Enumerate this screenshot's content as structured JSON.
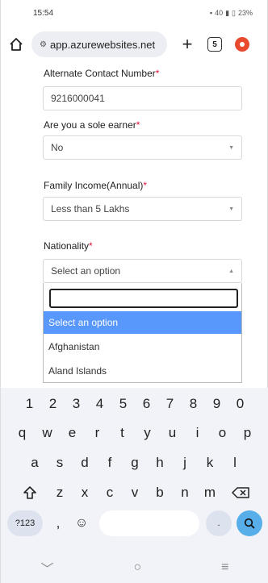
{
  "status": {
    "time": "15:54",
    "signal": "40",
    "battery": "23%"
  },
  "browser": {
    "url": "app.azurewebsites.net",
    "tab_count": "5",
    "plus": "+"
  },
  "form": {
    "alt_contact": {
      "label": "Alternate Contact Number",
      "value": "9216000041"
    },
    "sole_earner": {
      "label": "Are you a sole earner",
      "value": "No"
    },
    "family_income": {
      "label": "Family Income(Annual)",
      "value": "Less than 5 Lakhs"
    },
    "nationality": {
      "label": "Nationality",
      "value": "Select an option"
    },
    "required_mark": "*"
  },
  "dropdown": {
    "options": [
      "Select an option",
      "Afghanistan",
      "Aland Islands"
    ],
    "selected_index": 0
  },
  "keyboard": {
    "row1": [
      "1",
      "2",
      "3",
      "4",
      "5",
      "6",
      "7",
      "8",
      "9",
      "0"
    ],
    "row2": [
      "q",
      "w",
      "e",
      "r",
      "t",
      "y",
      "u",
      "i",
      "o",
      "p"
    ],
    "row3": [
      "a",
      "s",
      "d",
      "f",
      "g",
      "h",
      "j",
      "k",
      "l"
    ],
    "row4": [
      "z",
      "x",
      "c",
      "v",
      "b",
      "n",
      "m"
    ],
    "symbols_label": "?123",
    "comma": ",",
    "period": "."
  },
  "colors": {
    "accent": "#5897fb",
    "required": "#e0123a",
    "go_key": "#57aee8"
  }
}
